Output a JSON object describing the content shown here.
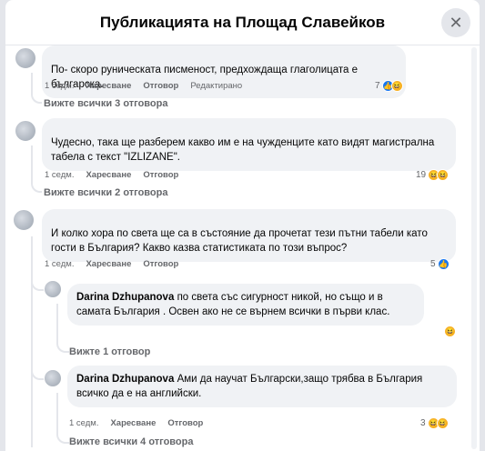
{
  "dialog": {
    "title": "Публикацията на Площад Славейков",
    "close_symbol": "✕"
  },
  "comments": [
    {
      "text": "По- скоро руническата писменост, предхождаща глаголицата е българска.",
      "time": "1 седм.",
      "like": "Харесване",
      "reply": "Отговор",
      "edited": "Редактирано",
      "reaction_count": "7",
      "reactions": [
        "like-icon",
        "haha-icon"
      ],
      "view_replies": "Вижте всички 3 отговора"
    },
    {
      "text": "Чудесно, така ще разберем какво им е на чужденците като видят магистрална табела с текст \"IZLIZANE\".",
      "time": "1 седм.",
      "like": "Харесване",
      "reply": "Отговор",
      "reaction_count": "19",
      "reactions": [
        "haha-icon",
        "haha-icon"
      ],
      "view_replies": "Вижте всички 2 отговора"
    },
    {
      "text": "И колко хора по света ще са в състояние да прочетат тези пътни табели като гости в България? Какво казва статистиката по този въпрос?",
      "time": "1 седм.",
      "like": "Харесване",
      "reply": "Отговор",
      "reaction_count": "5",
      "reactions": [
        "like-icon"
      ]
    }
  ],
  "replies": [
    {
      "author": "Darina Dzhupanova",
      "text": "по света със сигурност никой, но също и в самата България . Освен ако не се върнем всички в първи клас.",
      "reactions": [
        "haha-icon"
      ],
      "view_replies": "Вижте 1 отговор"
    },
    {
      "author": "Darina Dzhupanova",
      "text": "Ами да научат Български,защо трябва в България всичко да е на английски.",
      "time": "1 седм.",
      "like": "Харесване",
      "reply": "Отговор",
      "reaction_count": "3",
      "reactions": [
        "haha-icon",
        "haha-icon"
      ],
      "view_replies": "Вижте всички 4 отговора"
    }
  ]
}
